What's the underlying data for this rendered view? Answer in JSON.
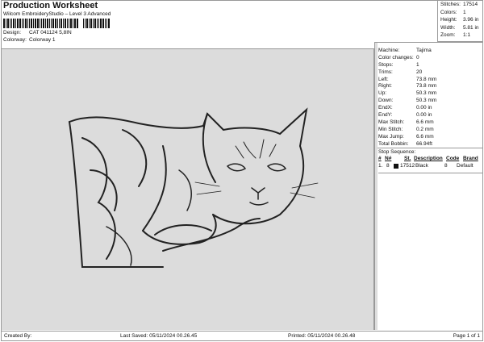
{
  "header": {
    "title": "Production Worksheet",
    "subtitle": "Wilcom EmbroideryStudio – Level 3 Advanced",
    "design_label": "Design:",
    "design_value": "CAT 041124 5,8IN",
    "colorway_label": "Colorway:",
    "colorway_value": "Colorway 1"
  },
  "stats": [
    {
      "k": "Stitches:",
      "v": "17514"
    },
    {
      "k": "Colors:",
      "v": "1"
    },
    {
      "k": "Height:",
      "v": "3.96 in"
    },
    {
      "k": "Width:",
      "v": "5.81 in"
    },
    {
      "k": "Zoom:",
      "v": "1:1"
    }
  ],
  "info": [
    {
      "k": "Machine:",
      "v": "Tajima"
    },
    {
      "k": "Color changes:",
      "v": "0"
    },
    {
      "k": "Stops:",
      "v": "1"
    },
    {
      "k": "Trims:",
      "v": "20"
    },
    {
      "k": "Left:",
      "v": "73.8 mm"
    },
    {
      "k": "Right:",
      "v": "73.8 mm"
    },
    {
      "k": "Up:",
      "v": "50.3 mm"
    },
    {
      "k": "Down:",
      "v": "50.3 mm"
    },
    {
      "k": "EndX:",
      "v": "0.00 in"
    },
    {
      "k": "EndY:",
      "v": "0.00 in"
    },
    {
      "k": "Max Stitch:",
      "v": "6.6 mm"
    },
    {
      "k": "Min Stitch:",
      "v": "0.2 mm"
    },
    {
      "k": "Max Jump:",
      "v": "6.6 mm"
    },
    {
      "k": "Total Bobbin:",
      "v": "66.94ft"
    }
  ],
  "stop_sequence": {
    "title": "Stop Sequence:",
    "headers": [
      "#",
      "N#",
      "St.",
      "Description",
      "Code",
      "Brand"
    ],
    "rows": [
      {
        "num": "1.",
        "needle": "8",
        "stitches": "17512",
        "description": "Black",
        "code": "8",
        "brand": "Default",
        "color": "#111111"
      }
    ]
  },
  "footer": {
    "created_by": "Created By:",
    "last_saved": "Last Saved: 05/11/2024 00.26.45",
    "printed": "Printed: 05/11/2024 00.26.48",
    "page": "Page 1 of 1"
  }
}
